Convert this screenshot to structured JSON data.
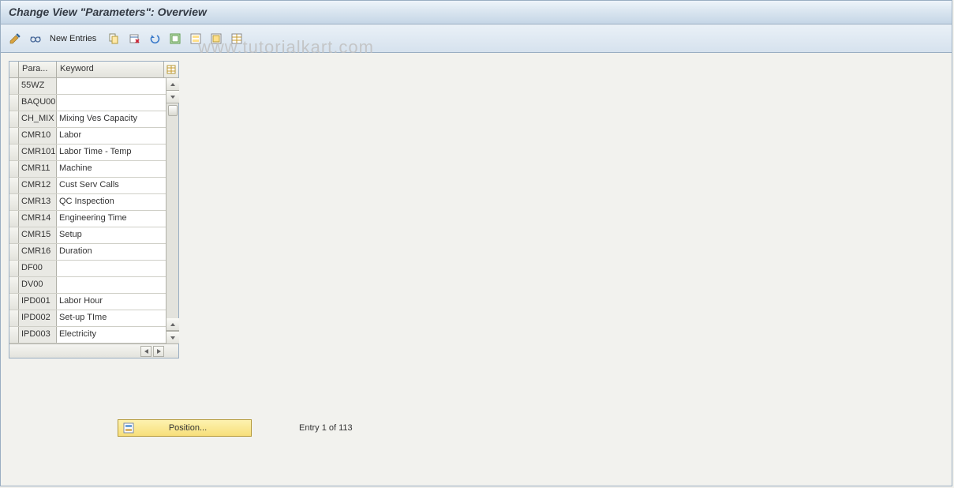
{
  "title": "Change View \"Parameters\": Overview",
  "toolbar": {
    "new_entries": "New Entries"
  },
  "table": {
    "headers": {
      "param": "Para...",
      "keyword": "Keyword"
    },
    "rows": [
      {
        "param": "55WZ",
        "keyword": ""
      },
      {
        "param": "BAQU00",
        "keyword": ""
      },
      {
        "param": "CH_MIX",
        "keyword": "Mixing Ves Capacity"
      },
      {
        "param": "CMR10",
        "keyword": "Labor"
      },
      {
        "param": "CMR101",
        "keyword": "Labor Time - Temp"
      },
      {
        "param": "CMR11",
        "keyword": "Machine"
      },
      {
        "param": "CMR12",
        "keyword": "Cust Serv Calls"
      },
      {
        "param": "CMR13",
        "keyword": "QC Inspection"
      },
      {
        "param": "CMR14",
        "keyword": "Engineering Time"
      },
      {
        "param": "CMR15",
        "keyword": "Setup"
      },
      {
        "param": "CMR16",
        "keyword": "Duration"
      },
      {
        "param": "DF00",
        "keyword": ""
      },
      {
        "param": "DV00",
        "keyword": ""
      },
      {
        "param": "IPD001",
        "keyword": "Labor Hour"
      },
      {
        "param": "IPD002",
        "keyword": "Set-up TIme"
      },
      {
        "param": "IPD003",
        "keyword": "Electricity"
      }
    ]
  },
  "position_button": "Position...",
  "entry_status": "Entry 1 of 113",
  "watermark": "www.tutorialkart.com"
}
